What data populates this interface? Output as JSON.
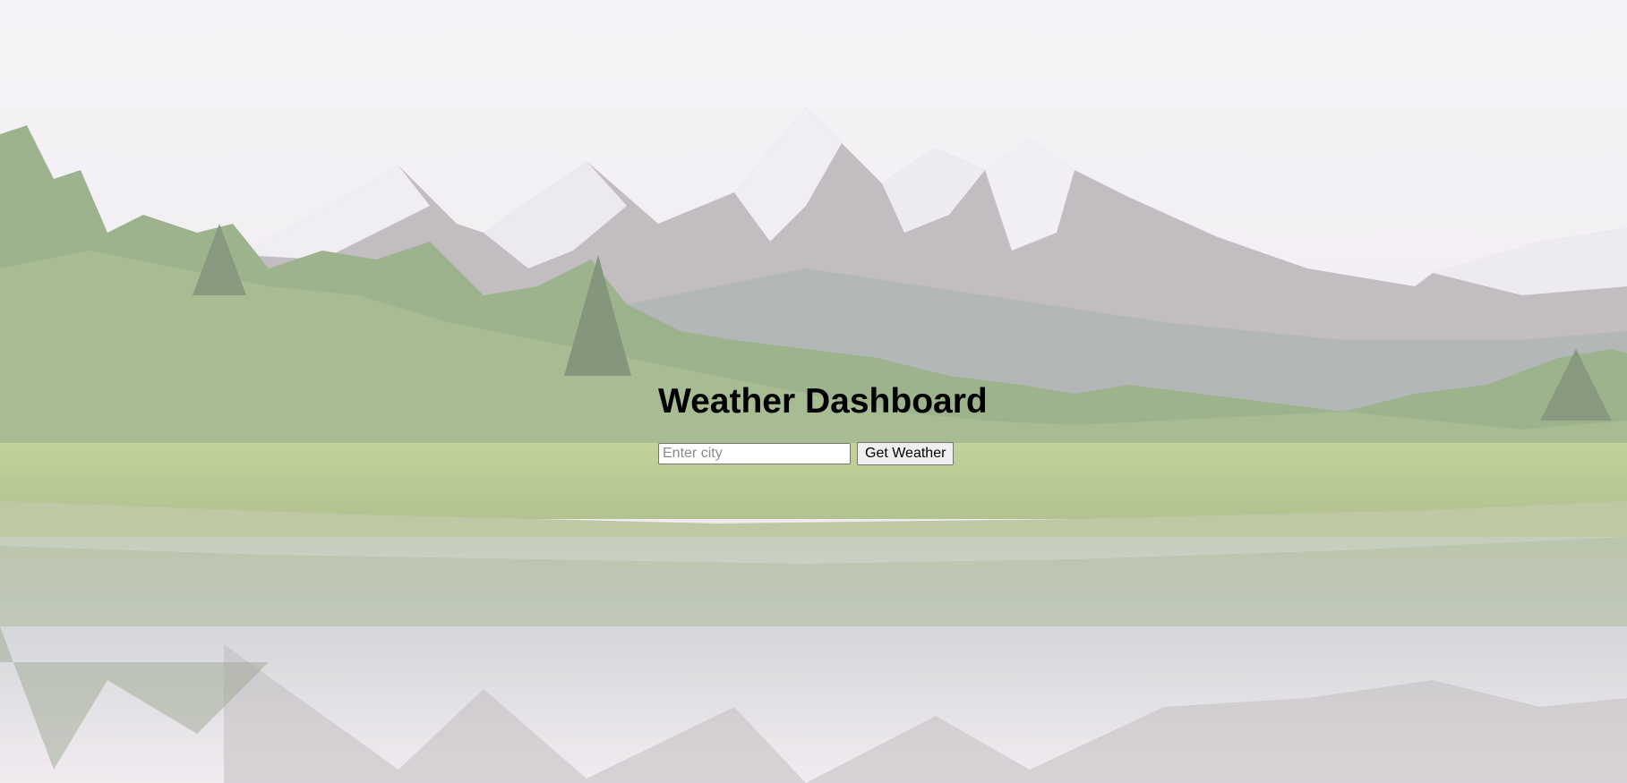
{
  "header": {
    "title": "Weather Dashboard"
  },
  "search": {
    "placeholder": "Enter city",
    "value": "",
    "button_label": "Get Weather"
  },
  "background": {
    "scene": "mountain-lake-landscape"
  }
}
